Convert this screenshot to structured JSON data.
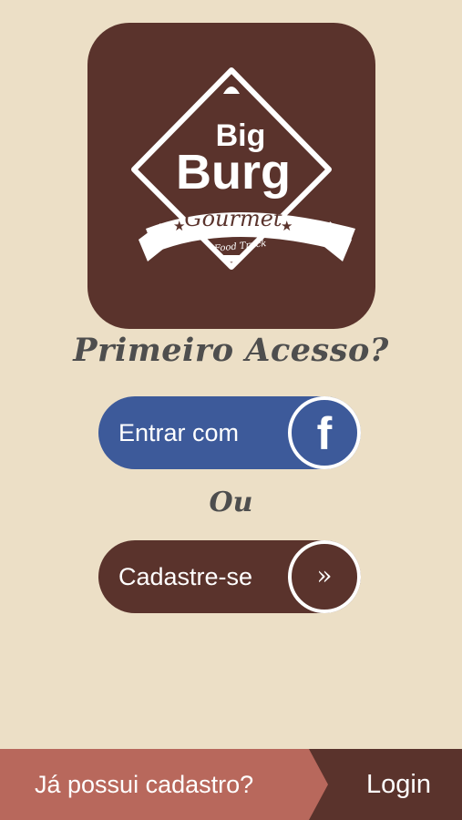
{
  "logo": {
    "line1": "Big",
    "line2": "Burg",
    "ribbon": "Gourmet",
    "tagline": "Food Truck"
  },
  "welcome": {
    "question": "Primeiro Acesso?",
    "or": "Ou"
  },
  "facebook_button": {
    "label": "Entrar com",
    "icon": "facebook-icon"
  },
  "register_button": {
    "label": "Cadastre-se",
    "icon": "double-chevron-right-icon",
    "icon_glyph": "»"
  },
  "bottom_bar": {
    "question": "Já possui cadastro?",
    "login_label": "Login"
  },
  "colors": {
    "background": "#ecdfc6",
    "brand_brown": "#5a332c",
    "facebook_blue": "#3d5a9a",
    "bottom_accent": "#b8685c",
    "heading_gray": "#4e4e4e"
  }
}
